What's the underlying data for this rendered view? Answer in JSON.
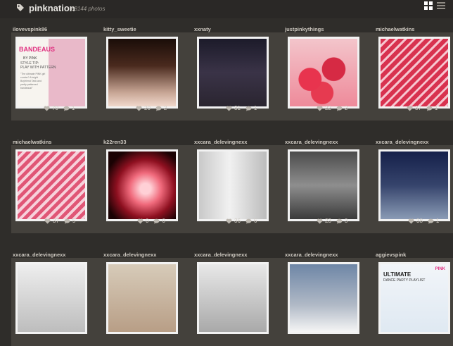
{
  "header": {
    "brand": "pinknation",
    "photo_count": "68144 photos"
  },
  "icons": {
    "brand": "tag-icon",
    "grid_view": "grid-view-icon",
    "list_view": "list-view-icon",
    "like": "heart-icon",
    "comment": "comment-icon"
  },
  "photos": [
    {
      "user": "ilovevspink86",
      "likes": "70",
      "comments": "1",
      "text": {
        "t1": "BANDEAUS",
        "t2": "BY PINK",
        "t3": "STYLE TIP:",
        "t4": "PLAY WITH PATTERN",
        "t5": "\"The ultimate PINK girl combo? A bright Boyfriend Tank and pretty patterned bandeaus!\""
      }
    },
    {
      "user": "kitty_sweetie",
      "likes": "20",
      "comments": "2"
    },
    {
      "user": "xxnaty",
      "likes": "31",
      "comments": "1"
    },
    {
      "user": "justpinkythings",
      "likes": "22",
      "comments": "2"
    },
    {
      "user": "michaelwatkins",
      "likes": "37",
      "comments": "1"
    },
    {
      "user": "michaelwatkins",
      "likes": "37",
      "comments": "5"
    },
    {
      "user": "k22ren33",
      "likes": "0",
      "comments": "0"
    },
    {
      "user": "xxcara_delevingnexx",
      "likes": "36",
      "comments": "6"
    },
    {
      "user": "xxcara_delevingnexx",
      "likes": "23",
      "comments": "3"
    },
    {
      "user": "xxcara_delevingnexx",
      "likes": "38",
      "comments": "1"
    },
    {
      "user": "xxcara_delevingnexx"
    },
    {
      "user": "xxcara_delevingnexx"
    },
    {
      "user": "xxcara_delevingnexx"
    },
    {
      "user": "xxcara_delevingnexx"
    },
    {
      "user": "aggievspink",
      "text": {
        "a1": "ULTIMATE",
        "a2": "DANCE PARTY PLAYLIST",
        "a3": "PINK"
      }
    }
  ],
  "colors": {
    "background": "#2f2d2a",
    "card": "#44413c",
    "accent_pink": "#e02f7f"
  }
}
